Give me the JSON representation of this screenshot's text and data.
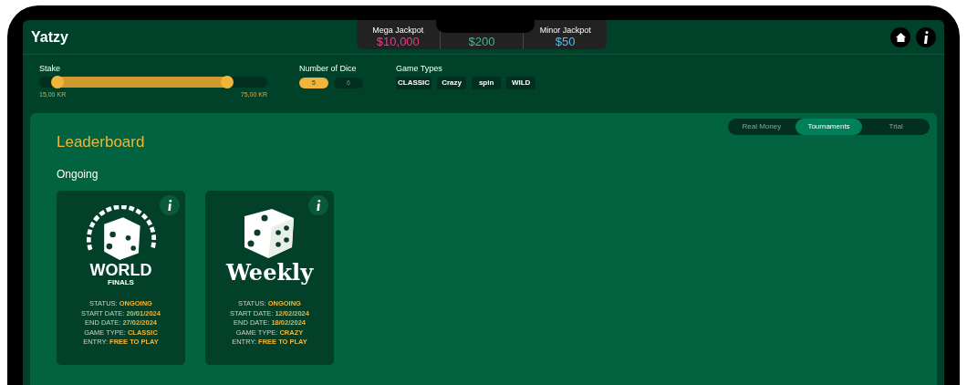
{
  "app": {
    "title": "Yatzy"
  },
  "jackpots": [
    {
      "label": "Mega Jackpot",
      "amount": "$10,000",
      "color": "#e0408a"
    },
    {
      "amount": "$200",
      "color": "#3fb59a"
    },
    {
      "label": "Minor Jackpot",
      "amount": "$50",
      "color": "#5cb8e6"
    }
  ],
  "stake": {
    "label": "Stake",
    "thumbs": [
      {
        "level": 0.08
      },
      {
        "level": 0.825
      }
    ],
    "min": "15,00 KR",
    "max": "75,00 KR"
  },
  "dice": {
    "label": "Number of Dice",
    "options": [
      {
        "label": "5",
        "selected": true
      },
      {
        "label": "6",
        "selected": false
      }
    ]
  },
  "game_types": {
    "label": "Game Types",
    "items": [
      "CLASSIC",
      "Crazy",
      "spin",
      "WILD"
    ]
  },
  "tabs": [
    {
      "label": "Real Money",
      "selected": false
    },
    {
      "label": "Tournaments",
      "selected": true
    },
    {
      "label": "Trial",
      "selected": false
    }
  ],
  "leaderboard": {
    "title": "Leaderboard",
    "section": "Ongoing",
    "cards": [
      {
        "kind": "world",
        "logo": [
          "WORLD",
          "FINALS"
        ],
        "fields": [
          {
            "label": "STATUS:",
            "value": "ONGOING"
          },
          {
            "label": "START DATE:",
            "value": "20/01/2024"
          },
          {
            "label": "END DATE:",
            "value": "27/02/2024"
          },
          {
            "label": "GAME TYPE:",
            "value": "CLASSIC"
          },
          {
            "label": "ENTRY:",
            "value": "FREE TO PLAY"
          }
        ]
      },
      {
        "kind": "weekly",
        "logo": [
          "Weekly"
        ],
        "fields": [
          {
            "label": "STATUS:",
            "value": "ONGOING"
          },
          {
            "label": "START DATE:",
            "value": "12/02/2024"
          },
          {
            "label": "END DATE:",
            "value": "18/02/2024"
          },
          {
            "label": "GAME TYPE:",
            "value": "CRAZY"
          },
          {
            "label": "ENTRY:",
            "value": "FREE TO PLAY"
          }
        ]
      }
    ]
  }
}
